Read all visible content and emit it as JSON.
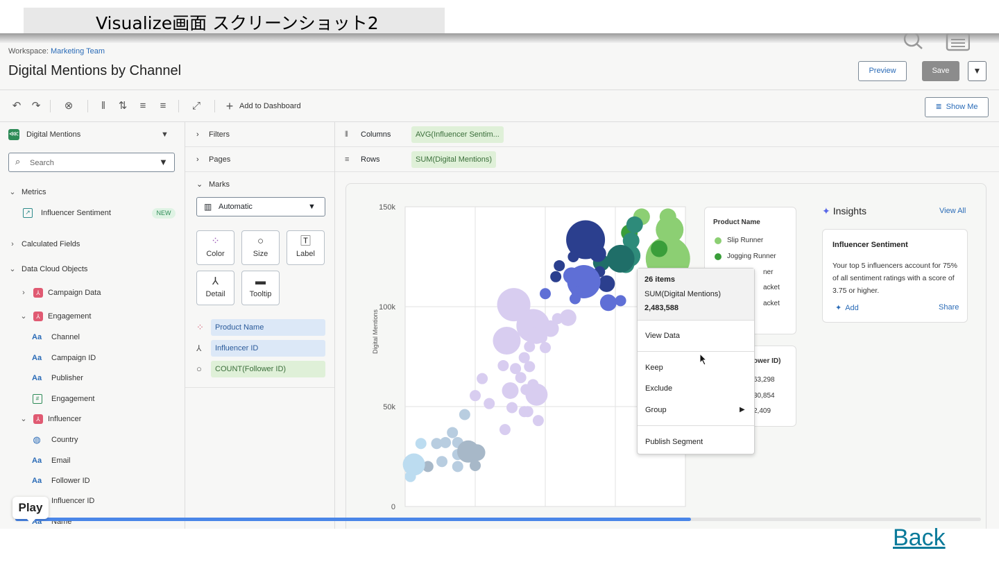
{
  "caption": "Visualize画面 スクリーンショット2",
  "header": {
    "workspace_label": "Workspace:",
    "workspace_name": "Marketing Team",
    "title": "Digital Mentions by Channel",
    "preview_label": "Preview",
    "save_label": "Save",
    "caret": "▼"
  },
  "toolbar": {
    "add_to_dashboard": "Add to Dashboard",
    "show_me": "Show Me",
    "undo_icon": "↶",
    "redo_icon": "↷",
    "clear_icon": "⊗",
    "pause_icon": "‖",
    "swap_icon": "⇅",
    "sort_asc_icon": "≡",
    "sort_desc_icon": "≡",
    "fit_icon": "⤢",
    "plus_icon": "+",
    "show_me_icon": "≣"
  },
  "left_panel": {
    "source_name": "Digital Mentions",
    "search_placeholder": "Search",
    "metrics_label": "Metrics",
    "metric_item": "Influencer Sentiment",
    "new_badge": "NEW",
    "calculated_fields": "Calculated Fields",
    "data_cloud_objects": "Data Cloud Objects",
    "campaign_data": "Campaign Data",
    "engagement": "Engagement",
    "engagement_fields": [
      "Channel",
      "Campaign ID",
      "Publisher",
      "Engagement"
    ],
    "influencer": "Influencer",
    "influencer_fields": [
      "Country",
      "Email",
      "Follower ID",
      "Influencer ID",
      "Name"
    ]
  },
  "mid_panel": {
    "filters": "Filters",
    "pages": "Pages",
    "marks": "Marks",
    "mark_type": "Automatic",
    "mark_buttons": [
      "Color",
      "Size",
      "Label",
      "Detail",
      "Tooltip"
    ],
    "pills": [
      "Product Name",
      "Influencer ID",
      "COUNT(Follower ID)"
    ]
  },
  "shelves": {
    "columns_label": "Columns",
    "columns_value": "AVG(Influencer Sentim...",
    "rows_label": "Rows",
    "rows_value": "SUM(Digital Mentions)"
  },
  "colors": {
    "slip_runner": "#8ccf73",
    "jogging_runner": "#3a9e3a",
    "teal": "#2e8b7a",
    "dark_teal": "#1f6e68",
    "navy": "#2b3f8e",
    "indigo": "#5f6fd6",
    "lavender": "#d8cdf0",
    "light_lavender": "#e6ddf5",
    "pale_blue": "#b8cde0",
    "light_blue": "#bcdcf0",
    "grey_blue": "#a7b8c8",
    "accent": "#2a6bb7"
  },
  "chart_data": {
    "type": "scatter",
    "title": "",
    "xlabel": "",
    "ylabel": "Digital Mentions",
    "ylim": [
      0,
      150000
    ],
    "yticks": [
      "150k",
      "100k",
      "50k",
      "0"
    ],
    "grid": true,
    "series": [
      {
        "name": "Slip Runner",
        "color_key": "slip_runner",
        "points": [
          [
            4.1,
            145000,
            3
          ],
          [
            4.25,
            145000,
            3
          ],
          [
            4.26,
            138500,
            5
          ],
          [
            4.25,
            124000,
            8
          ]
        ]
      },
      {
        "name": "Jogging Runner",
        "color_key": "jogging_runner",
        "points": [
          [
            4.03,
            137000,
            3
          ],
          [
            4.2,
            129000,
            3
          ]
        ]
      },
      {
        "name": "",
        "color_key": "teal",
        "points": [
          [
            4.06,
            141000,
            3
          ],
          [
            4.04,
            133000,
            3
          ],
          [
            4.03,
            125500,
            4
          ],
          [
            4.01,
            121000,
            3
          ]
        ]
      },
      {
        "name": "",
        "color_key": "dark_teal",
        "points": [
          [
            3.98,
            124000,
            5
          ],
          [
            3.87,
            122000,
            3
          ]
        ]
      },
      {
        "name": "",
        "color_key": "navy",
        "points": [
          [
            3.78,
            133500,
            7
          ],
          [
            3.85,
            126500,
            3
          ],
          [
            3.71,
            125000,
            2
          ],
          [
            3.63,
            120500,
            2
          ],
          [
            3.86,
            117500,
            2
          ],
          [
            3.61,
            115000,
            2
          ],
          [
            3.9,
            111500,
            3
          ],
          [
            3.8,
            108500,
            2
          ]
        ]
      },
      {
        "name": "",
        "color_key": "indigo",
        "points": [
          [
            3.7,
            115500,
            3
          ],
          [
            3.77,
            112500,
            6
          ],
          [
            3.73,
            107500,
            2
          ],
          [
            3.55,
            106500,
            2
          ],
          [
            3.91,
            102000,
            3
          ],
          [
            3.72,
            104000,
            2
          ],
          [
            3.98,
            103000,
            2
          ]
        ]
      },
      {
        "name": "",
        "color_key": "lavender",
        "points": [
          [
            3.37,
            101000,
            6
          ],
          [
            3.48,
            90500,
            6
          ],
          [
            3.5,
            85500,
            3
          ],
          [
            3.33,
            83000,
            5
          ],
          [
            3.68,
            94500,
            3
          ],
          [
            3.62,
            94000,
            2
          ],
          [
            3.58,
            89000,
            3
          ],
          [
            3.53,
            84500,
            2
          ],
          [
            3.46,
            80000,
            2
          ],
          [
            3.43,
            74500,
            2
          ],
          [
            3.31,
            70500,
            2
          ],
          [
            3.55,
            79500,
            2
          ],
          [
            3.46,
            70000,
            2
          ],
          [
            3.38,
            69000,
            2
          ],
          [
            3.19,
            64000,
            2
          ],
          [
            3.41,
            64500,
            2
          ],
          [
            3.44,
            58500,
            2
          ],
          [
            3.35,
            58000,
            3
          ],
          [
            3.5,
            56000,
            4
          ],
          [
            3.48,
            61000,
            2
          ],
          [
            3.15,
            55500,
            2
          ],
          [
            3.23,
            51500,
            2
          ],
          [
            3.36,
            49500,
            2
          ],
          [
            3.45,
            47500,
            2
          ],
          [
            3.51,
            43000,
            2
          ],
          [
            3.43,
            47500,
            2
          ],
          [
            3.32,
            38500,
            2
          ]
        ]
      },
      {
        "name": "",
        "color_key": "pale_blue",
        "points": [
          [
            3.09,
            46000,
            2
          ],
          [
            3.02,
            37000,
            2
          ],
          [
            3.05,
            32000,
            2
          ],
          [
            2.98,
            32000,
            2
          ],
          [
            3.08,
            27500,
            2
          ],
          [
            2.93,
            31500,
            2
          ],
          [
            3.05,
            26000,
            2
          ],
          [
            3.05,
            20000,
            2
          ],
          [
            2.96,
            22500,
            2
          ]
        ]
      },
      {
        "name": "",
        "color_key": "grey_blue",
        "points": [
          [
            3.11,
            27500,
            4
          ],
          [
            3.16,
            27000,
            3
          ],
          [
            3.15,
            20500,
            2
          ],
          [
            2.88,
            20000,
            2
          ]
        ]
      },
      {
        "name": "",
        "color_key": "light_blue",
        "points": [
          [
            2.84,
            31500,
            2
          ],
          [
            2.8,
            21000,
            4
          ],
          [
            2.78,
            15000,
            2
          ]
        ]
      }
    ]
  },
  "legend": {
    "title": "Product Name",
    "items": [
      {
        "label": "Slip Runner",
        "color_key": "slip_runner"
      },
      {
        "label": "Jogging Runner",
        "color_key": "jogging_runner"
      },
      {
        "label": "ner",
        "color_key": ""
      },
      {
        "label": "acket",
        "color_key": ""
      },
      {
        "label": "acket",
        "color_key": ""
      }
    ]
  },
  "legend2": {
    "title": "ower ID)",
    "values": [
      "63,298",
      "30,854",
      "2,409"
    ]
  },
  "tooltip": {
    "count": "26 items",
    "measure": "SUM(Digital Mentions)",
    "value": "2,483,588",
    "items": [
      "View Data",
      "Keep",
      "Exclude",
      "Group",
      "Publish Segment"
    ],
    "submenu_icon": "▶"
  },
  "insights": {
    "title": "Insights",
    "view_all": "View All",
    "card_title": "Influencer Sentiment",
    "card_body": "Your top 5 influencers account for 75% of all sentiment ratings with a score of 3.75 or higher.",
    "add": "Add",
    "share": "Share"
  },
  "player": {
    "play_label": "Play",
    "progress": 0.7
  },
  "back_link": "Back"
}
